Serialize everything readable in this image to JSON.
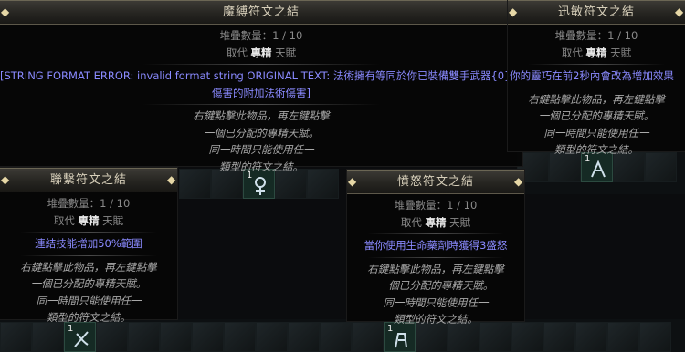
{
  "tooltips": [
    {
      "title": "魔縛符文之結",
      "stack": "堆疊數量：1 / 10",
      "replace_prefix": "取代",
      "replace_keyword": "專精",
      "replace_suffix": "天賦",
      "mod_line1": "[STRING FORMAT ERROR: invalid format string  ORIGINAL TEXT: 法術擁有等同於你已裝備雙手武器{0}%物理",
      "mod_line2": "傷害的附加法術傷害]",
      "flavor": [
        "右鍵點擊此物品，再左鍵點擊",
        "一個已分配的專精天賦。",
        "同一時間只能使用任一",
        "類型的符文之結。"
      ],
      "stack_count": "1",
      "icon": "rune-knot-icon"
    },
    {
      "title": "迅敏符文之結",
      "stack": "堆疊數量：1 / 10",
      "replace_prefix": "取代",
      "replace_keyword": "專精",
      "replace_suffix": "天賦",
      "mod_line1": "你的靈巧在前2秒內會改為增加效果",
      "flavor": [
        "右鍵點擊此物品，再左鍵點擊",
        "一個已分配的專精天賦。",
        "同一時間只能使用任一",
        "類型的符文之結。"
      ],
      "stack_count": "1",
      "icon": "rune-knot-icon"
    },
    {
      "title": "聯繫符文之結",
      "stack": "堆疊數量：1 / 10",
      "replace_prefix": "取代",
      "replace_keyword": "專精",
      "replace_suffix": "天賦",
      "mod_line1": "連結技能增加50%範圍",
      "flavor": [
        "右鍵點擊此物品，再左鍵點擊",
        "一個已分配的專精天賦。",
        "同一時間只能使用任一",
        "類型的符文之結。"
      ],
      "stack_count": "1",
      "icon": "rune-knot-icon"
    },
    {
      "title": "憤怒符文之結",
      "stack": "堆疊數量：1 / 10",
      "replace_prefix": "取代",
      "replace_keyword": "專精",
      "replace_suffix": "天賦",
      "mod_line1": "當你使用生命藥劑時獲得3盛怒",
      "flavor": [
        "右鍵點擊此物品，再左鍵點擊",
        "一個已分配的專精天賦。",
        "同一時間只能使用任一",
        "類型的符文之結。"
      ],
      "stack_count": "1",
      "icon": "rune-knot-icon"
    }
  ],
  "colors": {
    "mod": "#8a8aff",
    "header_text": "#d7cfba"
  }
}
